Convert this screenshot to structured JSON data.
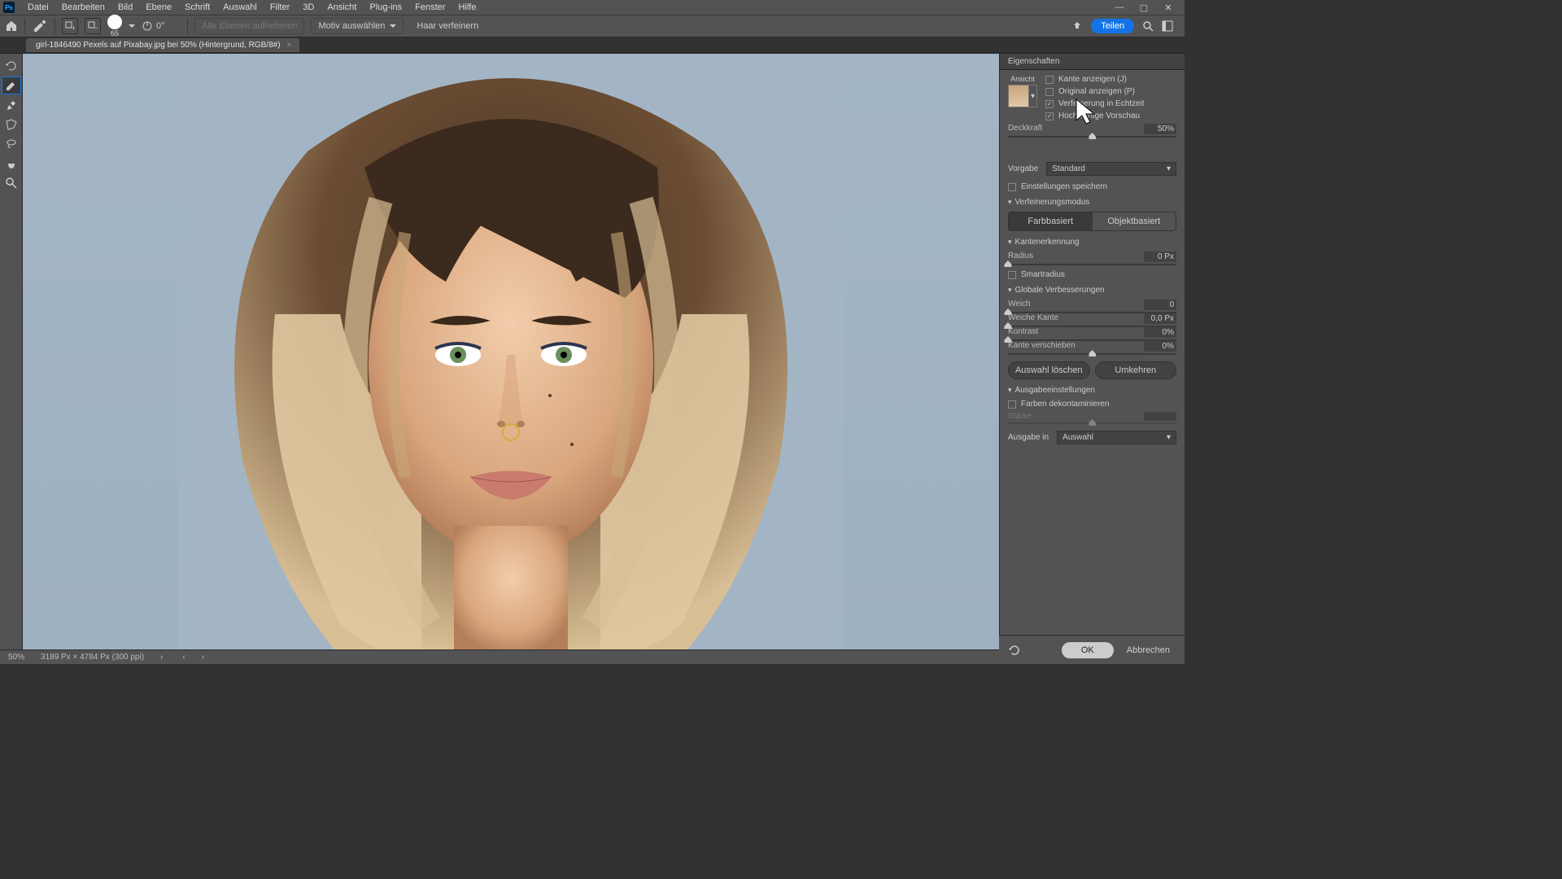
{
  "menu": {
    "items": [
      "Datei",
      "Bearbeiten",
      "Bild",
      "Ebene",
      "Schrift",
      "Auswahl",
      "Filter",
      "3D",
      "Ansicht",
      "Plug-ins",
      "Fenster",
      "Hilfe"
    ]
  },
  "options": {
    "brush_size_value": "65",
    "angle_value": "0°",
    "all_layers": "Alle Ebenen aufnehmen",
    "select_subject": "Motiv auswählen",
    "refine_hair": "Haar verfeinern",
    "share": "Teilen"
  },
  "tab": {
    "title": "girl-1846490 Pexels auf Pixabay.jpg bei 50% (Hintergrund, RGB/8#)"
  },
  "panel": {
    "title": "Eigenschaften",
    "view_label": "Ansicht",
    "chk_edge": "Kante anzeigen (J)",
    "chk_original": "Original anzeigen (P)",
    "chk_realtime": "Verfeinerung in Echtzeit",
    "chk_hq": "Hochwertige Vorschau",
    "opacity_label": "Deckkraft",
    "opacity_value": "50%",
    "preset_label": "Vorgabe",
    "preset_value": "Standard",
    "save_settings": "Einstellungen speichern",
    "refine_mode": "Verfeinerungsmodus",
    "color_based": "Farbbasiert",
    "object_based": "Objektbasiert",
    "edge_detect": "Kantenerkennung",
    "radius_label": "Radius",
    "radius_value": "0 Px",
    "smart_radius": "Smartradius",
    "global": "Globale Verbesserungen",
    "smooth_label": "Weich",
    "smooth_value": "0",
    "feather_label": "Weiche Kante",
    "feather_value": "0,0 Px",
    "contrast_label": "Kontrast",
    "contrast_value": "0%",
    "shift_label": "Kante verschieben",
    "shift_value": "0%",
    "clear_sel": "Auswahl löschen",
    "invert": "Umkehren",
    "output_settings": "Ausgabeeinstellungen",
    "decontaminate": "Farben dekontaminieren",
    "strength_label": "Stärke",
    "output_to_label": "Ausgabe in",
    "output_to_value": "Auswahl",
    "ok": "OK",
    "cancel": "Abbrechen"
  },
  "status": {
    "zoom": "50%",
    "dims": "3189 Px × 4784 Px (300 ppi)"
  }
}
